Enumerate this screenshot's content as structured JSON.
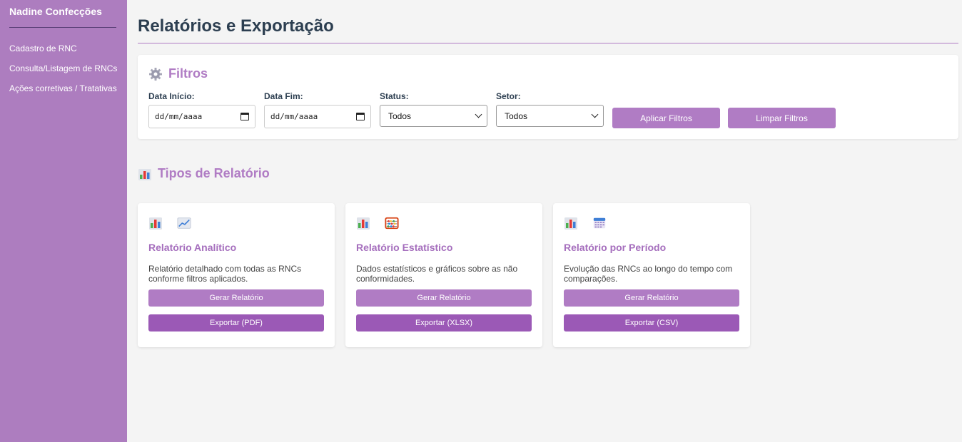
{
  "sidebar": {
    "brand": "Nadine Confecções",
    "items": [
      {
        "label": "Cadastro de RNC"
      },
      {
        "label": "Consulta/Listagem de RNCs"
      },
      {
        "label": "Ações corretivas / Tratativas"
      }
    ]
  },
  "page": {
    "title": "Relatórios e Exportação"
  },
  "filters": {
    "title": "Filtros",
    "icon": "gear-icon",
    "start_label": "Data Início:",
    "start_placeholder": "dd/mm/aaaa",
    "end_label": "Data Fim:",
    "end_placeholder": "dd/mm/aaaa",
    "status_label": "Status:",
    "status_value": "Todos",
    "sector_label": "Setor:",
    "sector_value": "Todos",
    "apply_label": "Aplicar Filtros",
    "clear_label": "Limpar Filtros"
  },
  "report_types": {
    "title": "Tipos de Relatório",
    "icon": "bar-chart-icon",
    "cards": [
      {
        "icons": [
          "bar-chart-icon",
          "line-chart-icon"
        ],
        "title": "Relatório Analítico",
        "description": "Relatório detalhado com todas as RNCs conforme filtros aplicados.",
        "generate_label": "Gerar Relatório",
        "export_label": "Exportar (PDF)"
      },
      {
        "icons": [
          "bar-chart-icon",
          "abacus-icon"
        ],
        "title": "Relatório Estatístico",
        "description": "Dados estatísticos e gráficos sobre as não conformidades.",
        "generate_label": "Gerar Relatório",
        "export_label": "Exportar (XLSX)"
      },
      {
        "icons": [
          "bar-chart-icon",
          "calendar-icon"
        ],
        "title": "Relatório por Período",
        "description": "Evolução das RNCs ao longo do tempo com comparações.",
        "generate_label": "Gerar Relatório",
        "export_label": "Exportar (CSV)"
      }
    ]
  },
  "colors": {
    "sidebar": "#ad7dbf",
    "accent": "#b07cc4",
    "export_button": "#9b59b6",
    "heading": "#2c3e50"
  }
}
